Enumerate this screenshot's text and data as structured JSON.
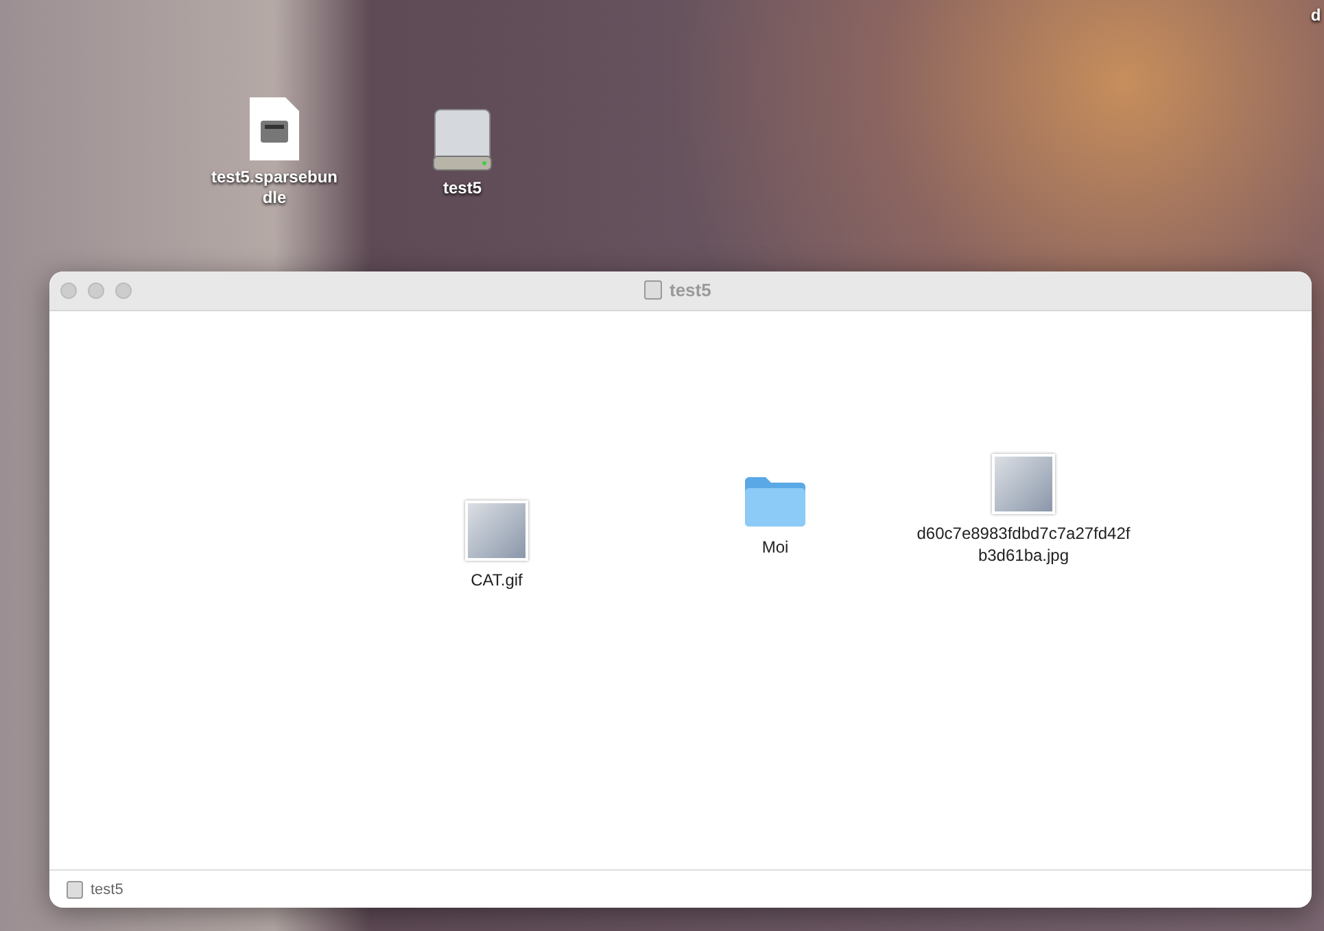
{
  "desktop_icons": [
    {
      "kind": "image",
      "label": "test5.sparsebundle"
    },
    {
      "kind": "drive",
      "label": "test5"
    },
    {
      "kind": "cut",
      "label": "d"
    }
  ],
  "window": {
    "title": "test5",
    "items": [
      {
        "kind": "photo",
        "label": "CAT.gif"
      },
      {
        "kind": "folder",
        "label": "Moi"
      },
      {
        "kind": "photo",
        "label": "d60c7e8983fdbd7c7a27fd42fb3d61ba.jpg"
      }
    ],
    "path_bar": "test5"
  }
}
